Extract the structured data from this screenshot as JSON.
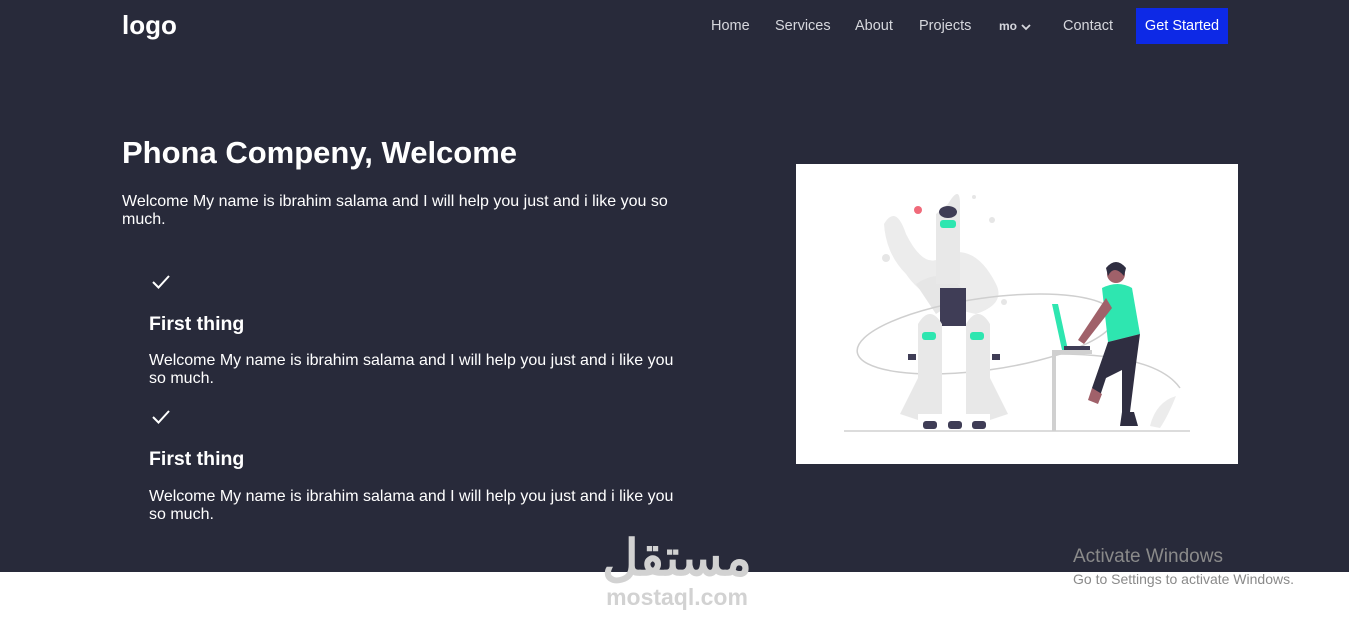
{
  "header": {
    "logo": "logo",
    "nav": {
      "home": "Home",
      "services": "Services",
      "about": "About",
      "projects": "Projects",
      "dropdown": "mo",
      "contact": "Contact"
    },
    "cta": "Get Started"
  },
  "hero": {
    "title": "Phona Compeny, Welcome",
    "text": "Welcome My name is ibrahim salama and I will help you just and i like you so much."
  },
  "features": [
    {
      "title": "First thing",
      "text": "Welcome My name is ibrahim salama and I will help you just and i like you so much."
    },
    {
      "title": "First thing",
      "text": "Welcome My name is ibrahim salama and I will help you just and i like you so much."
    }
  ],
  "watermark": {
    "arabic": "مستقل",
    "latin": "mostaql.com"
  },
  "os_overlay": {
    "title": "Activate Windows",
    "subtitle": "Go to Settings to activate Windows."
  },
  "colors": {
    "background": "#282a3a",
    "accent": "#0d29e6",
    "illustration_accent": "#2ee6b0"
  },
  "icons": [
    "check-icon",
    "chevron-down-icon"
  ]
}
